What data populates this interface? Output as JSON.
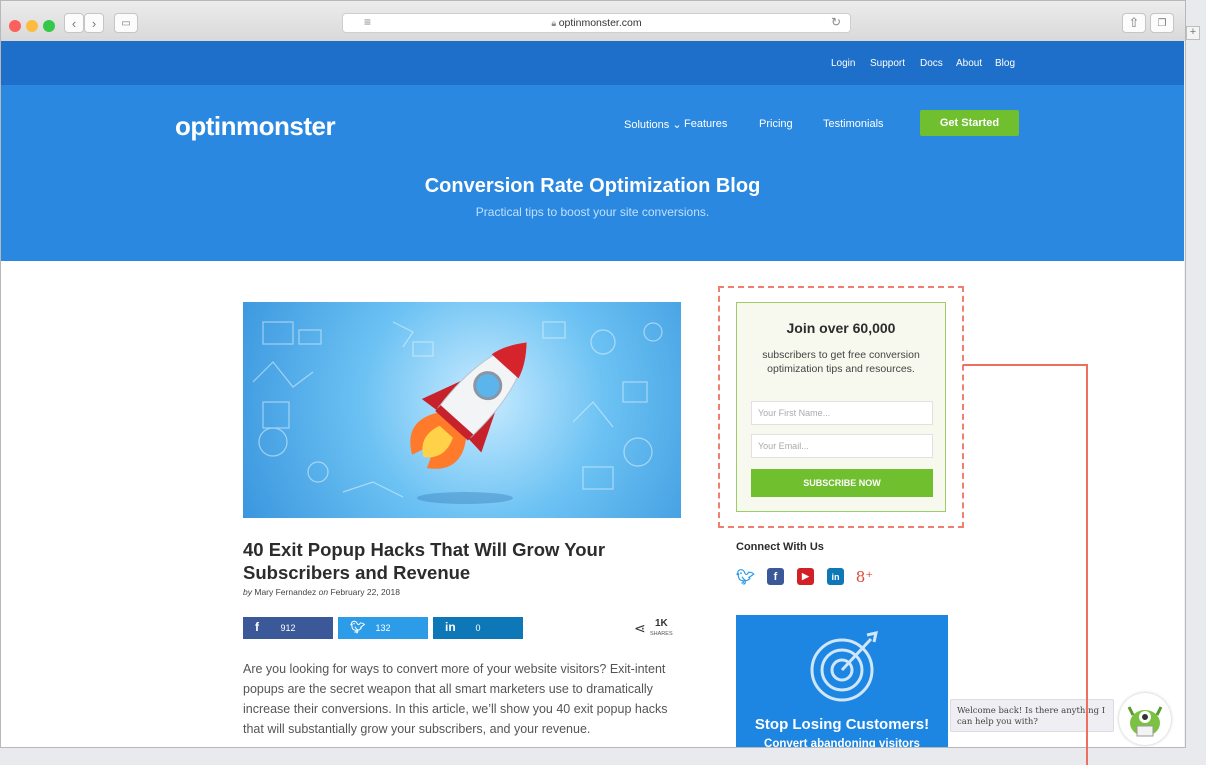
{
  "browser": {
    "url": "optinmonster.com"
  },
  "site": {
    "top_links": [
      "Login",
      "Support",
      "Docs",
      "About",
      "Blog"
    ],
    "logo": "optinmonster",
    "nav": {
      "solutions": "Solutions",
      "features": "Features",
      "pricing": "Pricing",
      "testimonials": "Testimonials",
      "cta": "Get Started"
    },
    "hero": {
      "title": "Conversion Rate Optimization Blog",
      "subtitle": "Practical tips to boost your site conversions."
    }
  },
  "article": {
    "title": "40 Exit Popup Hacks That Will Grow Your Subscribers and Revenue",
    "byline_by": "by",
    "author": "Mary Fernandez",
    "byline_on": "on",
    "date": "February 22, 2018",
    "shares": {
      "facebook": "912",
      "twitter": "132",
      "linkedin": "0",
      "total": "1K",
      "total_label": "SHARES"
    },
    "intro": "Are you looking for ways to convert more of your website visitors? Exit-intent popups are the secret weapon that all smart marketers use to dramatically increase their conversions. In this article, we’ll show you 40 exit popup hacks that will substantially grow your subscribers, and your revenue."
  },
  "optin": {
    "title": "Join over 60,000",
    "description": "subscribers to get free conversion optimization tips and resources.",
    "first_name_placeholder": "Your First Name...",
    "email_placeholder": "Your Email...",
    "button": "SUBSCRIBE NOW"
  },
  "connect": {
    "heading": "Connect With Us"
  },
  "promo": {
    "title": "Stop Losing Customers!",
    "subtitle": "Convert abandoning visitors"
  },
  "chat": {
    "message": "Welcome back! Is there anything I can help you with?"
  },
  "colors": {
    "brand_blue": "#2a88e0",
    "top_bar_blue": "#1e6fc9",
    "cta_green": "#6fbf2e",
    "annotation_red": "#ef6f5f"
  }
}
